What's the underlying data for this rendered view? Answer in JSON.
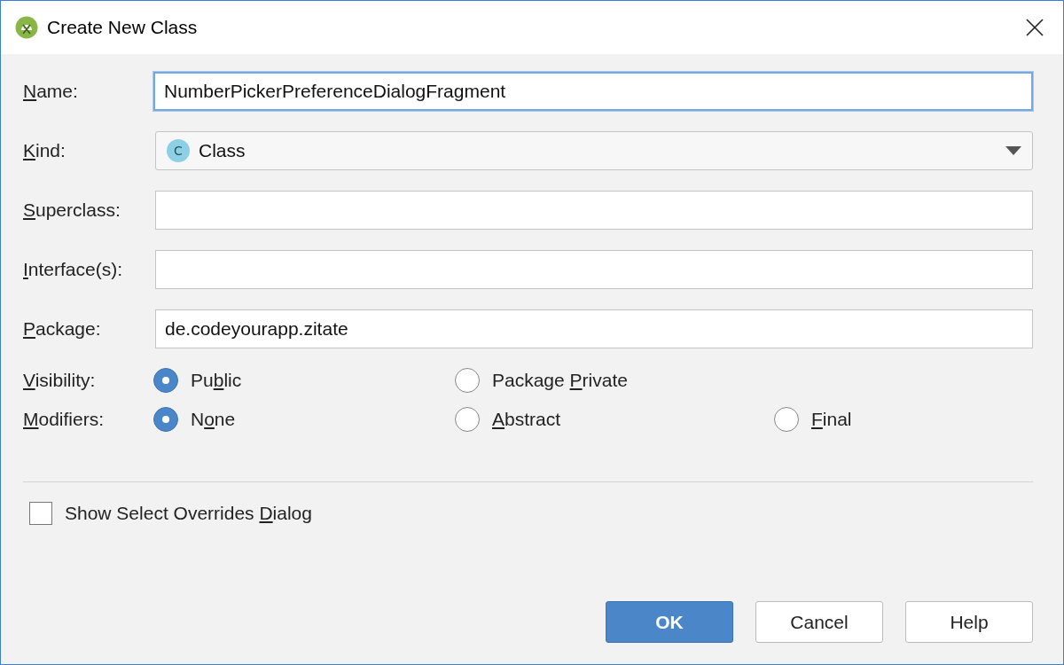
{
  "window": {
    "title": "Create New Class"
  },
  "fields": [
    {
      "kind": "text",
      "label": {
        "key": "N",
        "post": "ame:"
      },
      "value": "NumberPickerPreferenceDialogFragment",
      "focused": true
    },
    {
      "kind": "select",
      "label": {
        "key": "K",
        "post": "ind:"
      },
      "value": "Class",
      "icon_letter": "C",
      "focused": false
    },
    {
      "kind": "text",
      "label": {
        "key": "S",
        "post": "uperclass:"
      },
      "focused": false
    },
    {
      "kind": "text",
      "label": {
        "key": "I",
        "post": "nterface(s):"
      },
      "focused": false
    },
    {
      "kind": "text",
      "label": {
        "key": "P",
        "post": "ackage:"
      },
      "value": "de.codeyourapp.zitate",
      "focused": false
    }
  ],
  "radio_groups": [
    {
      "label": {
        "key": "V",
        "post": "isibility:"
      },
      "options": [
        {
          "label": {
            "pre": "Pu",
            "key": "b",
            "post": "lic"
          },
          "selected": true
        },
        {
          "label": {
            "pre": "Package ",
            "key": "P",
            "post": "rivate"
          },
          "selected": false
        }
      ]
    },
    {
      "label": {
        "key": "M",
        "post": "odifiers:"
      },
      "options": [
        {
          "label": {
            "pre": "N",
            "key": "o",
            "post": "ne"
          },
          "selected": true
        },
        {
          "label": {
            "key": "A",
            "post": "bstract"
          },
          "selected": false
        },
        {
          "label": {
            "key": "F",
            "post": "inal"
          },
          "selected": false
        }
      ]
    }
  ],
  "checkbox": {
    "label": {
      "pre": "Show Select Overrides ",
      "key": "D",
      "post": "ialog"
    },
    "checked": false
  },
  "buttons": [
    {
      "label": "OK",
      "default": true
    },
    {
      "label": "Cancel",
      "default": false
    },
    {
      "label": "Help",
      "default": false
    }
  ]
}
